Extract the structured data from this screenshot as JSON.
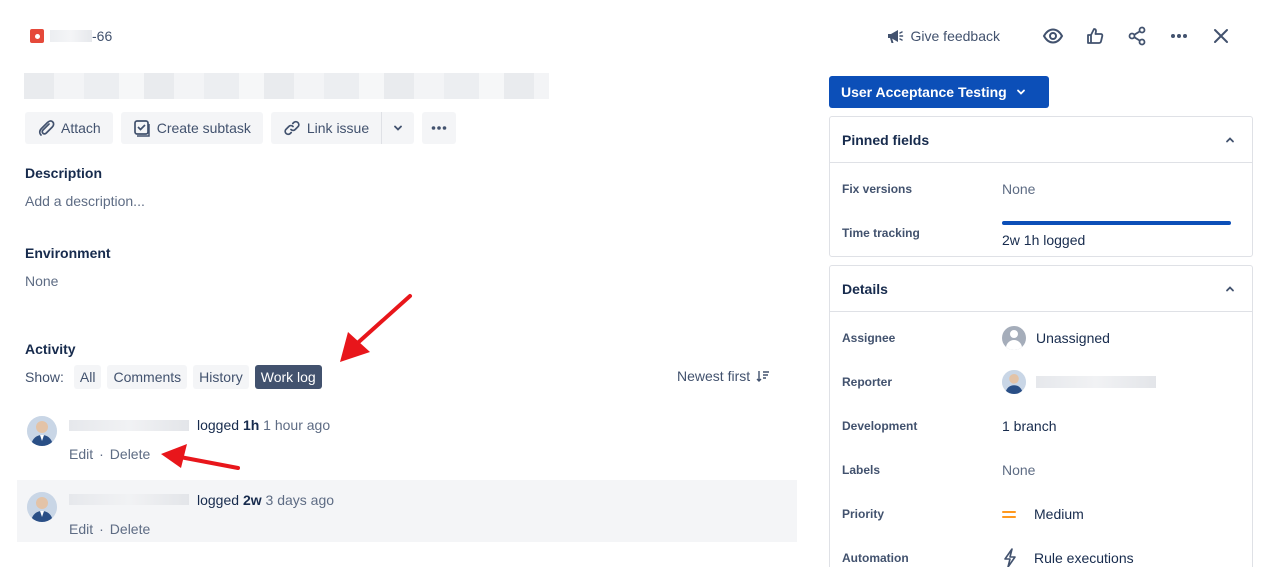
{
  "header": {
    "issue_key_suffix": "-66",
    "feedback_label": "Give feedback"
  },
  "toolbar": {
    "attach_label": "Attach",
    "subtask_label": "Create subtask",
    "link_label": "Link issue"
  },
  "description": {
    "title": "Description",
    "placeholder": "Add a description..."
  },
  "environment": {
    "title": "Environment",
    "value": "None"
  },
  "activity": {
    "title": "Activity",
    "show_label": "Show:",
    "filters": [
      "All",
      "Comments",
      "History",
      "Work log"
    ],
    "active_filter": "Work log",
    "sort_label": "Newest first",
    "entries": [
      {
        "action": "logged",
        "amount": "1h",
        "time": "1 hour ago",
        "edit": "Edit",
        "delete": "Delete"
      },
      {
        "action": "logged",
        "amount": "2w",
        "time": "3 days ago",
        "edit": "Edit",
        "delete": "Delete"
      }
    ]
  },
  "sidebar": {
    "status_label": "User Acceptance Testing",
    "pinned": {
      "title": "Pinned fields",
      "fix_versions_label": "Fix versions",
      "fix_versions_value": "None",
      "time_tracking_label": "Time tracking",
      "time_tracking_value": "2w 1h logged",
      "time_tracking_progress": 1.0
    },
    "details": {
      "title": "Details",
      "assignee_label": "Assignee",
      "assignee_value": "Unassigned",
      "reporter_label": "Reporter",
      "development_label": "Development",
      "development_value": "1 branch",
      "labels_label": "Labels",
      "labels_value": "None",
      "priority_label": "Priority",
      "priority_value": "Medium",
      "automation_label": "Automation",
      "automation_value": "Rule executions"
    }
  },
  "colors": {
    "accent": "#0c4fb8",
    "annotation_arrow": "#e8161b",
    "priority_medium": "#ff991f",
    "bug": "#e5493a"
  }
}
